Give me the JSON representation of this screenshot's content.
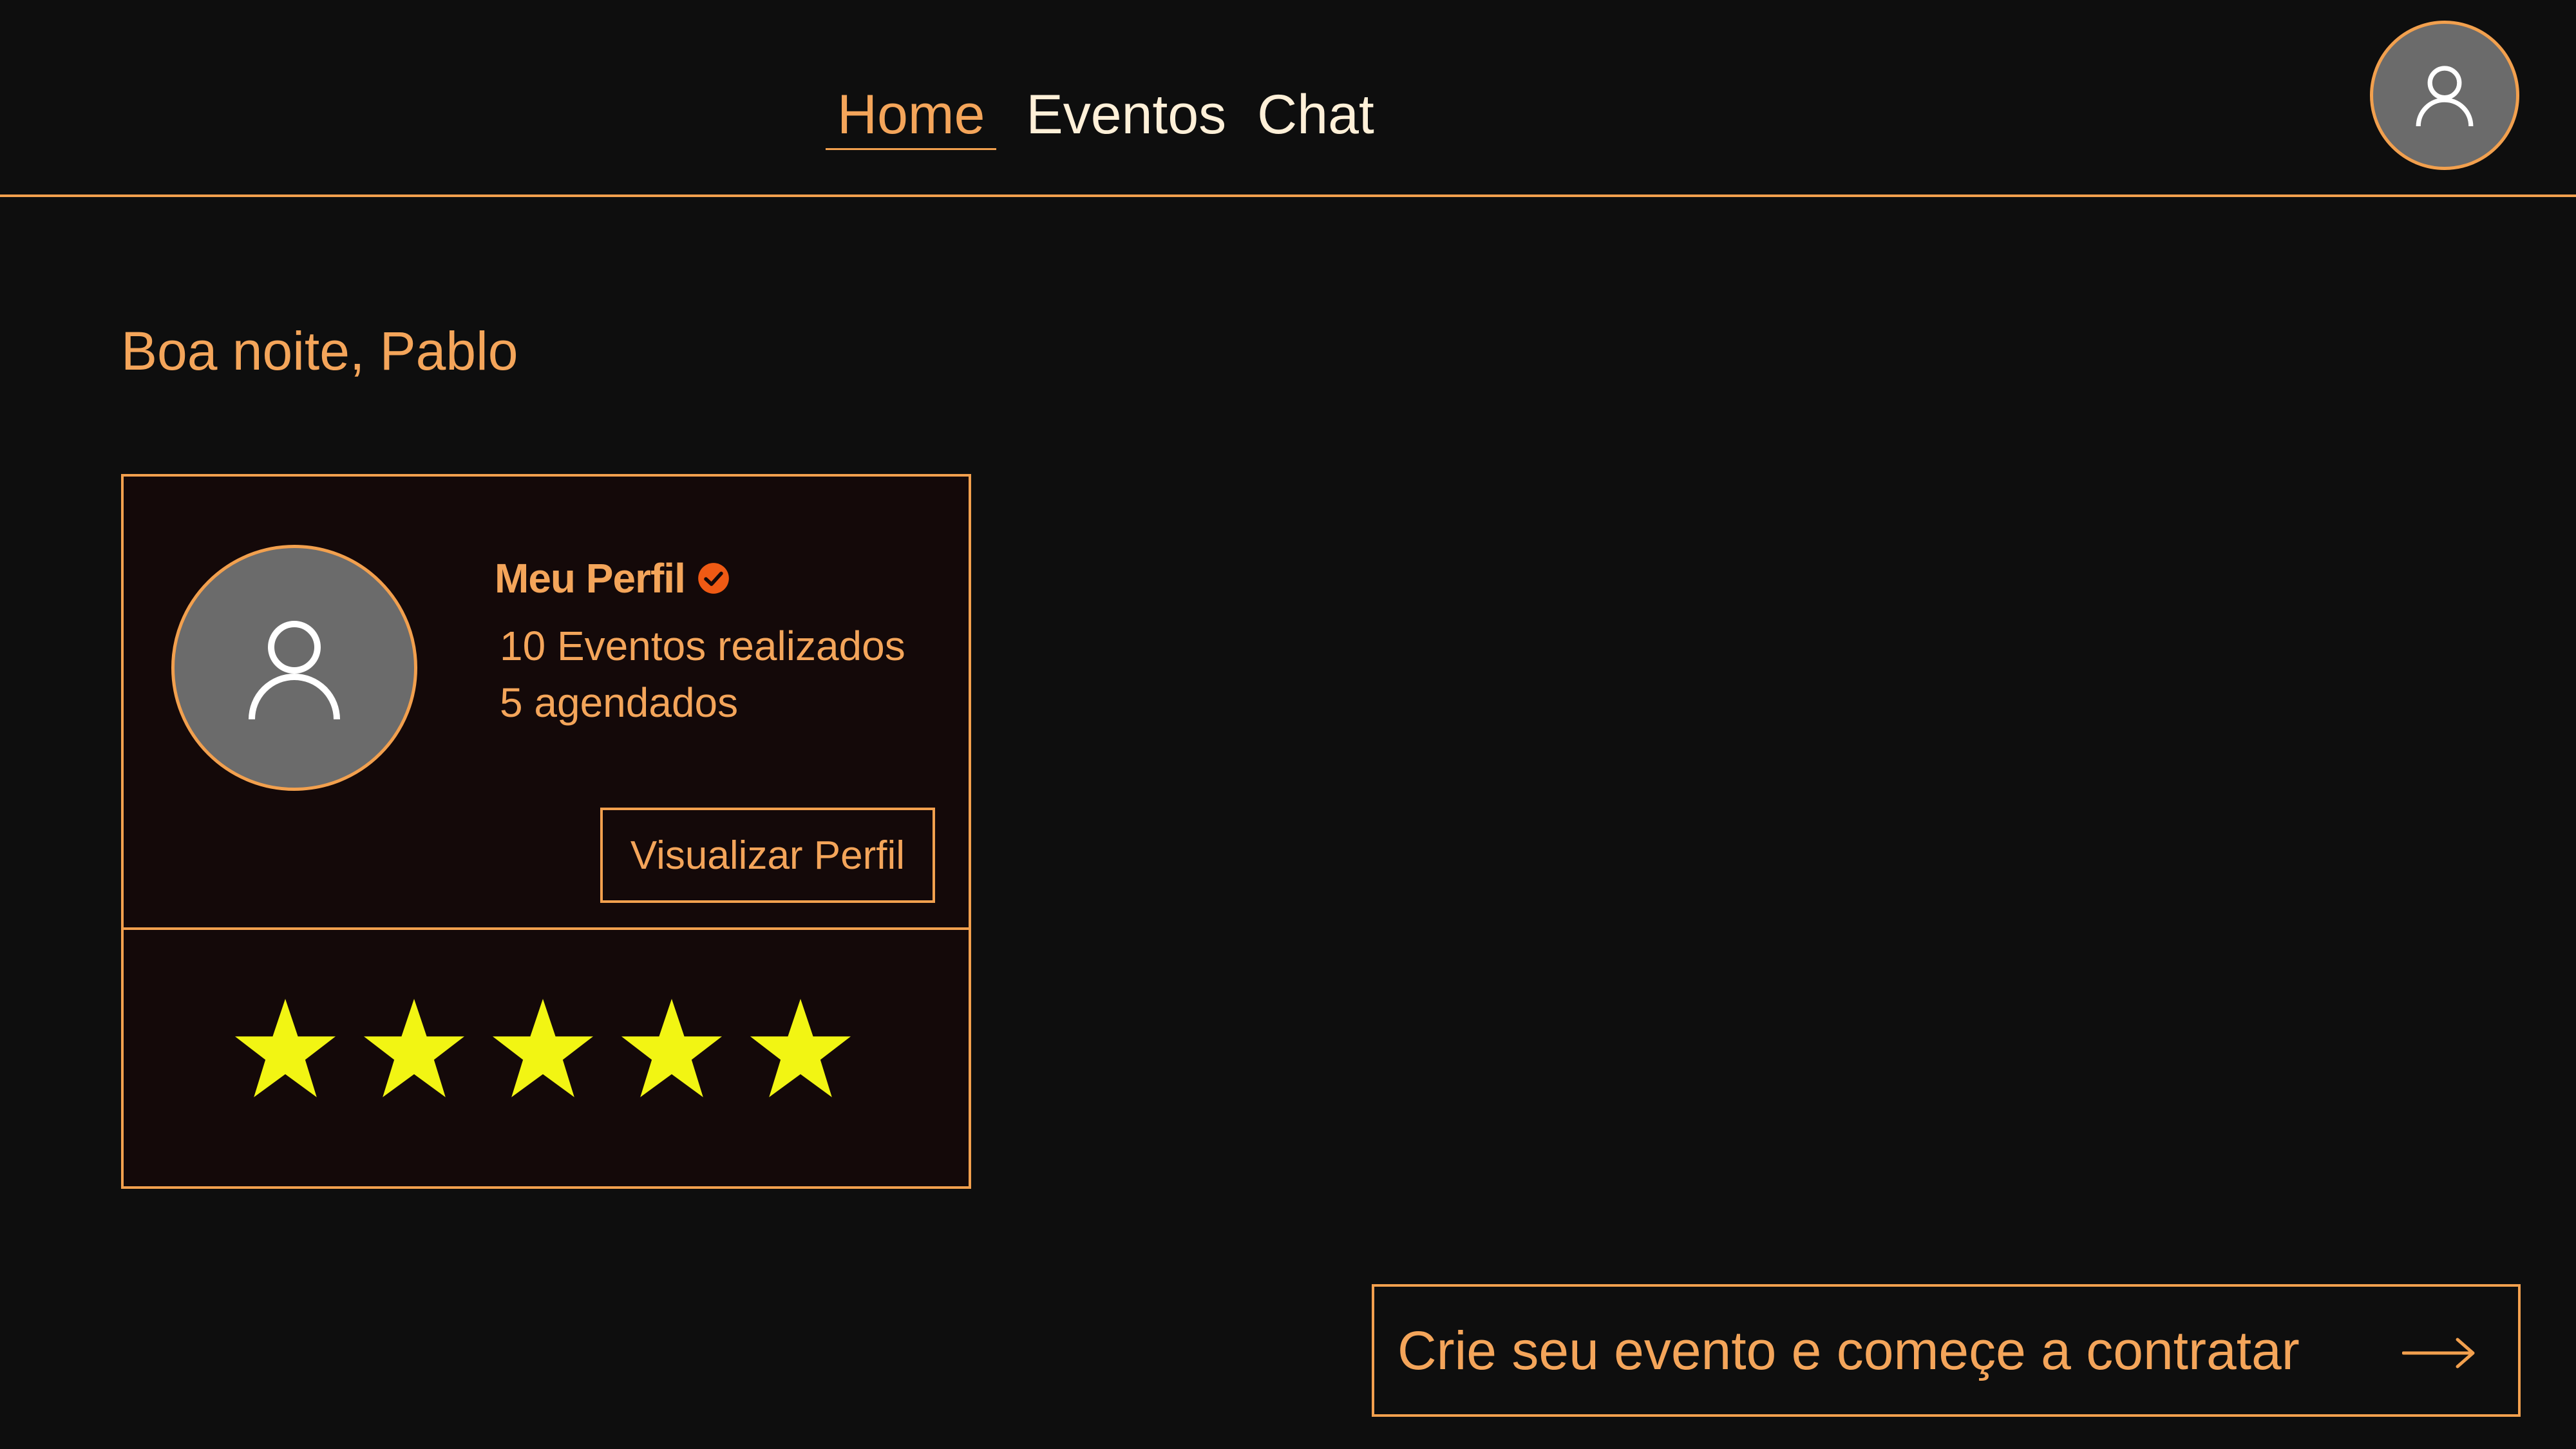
{
  "nav": {
    "items": [
      {
        "label": "Home",
        "active": true
      },
      {
        "label": "Eventos",
        "active": false
      },
      {
        "label": "Chat",
        "active": false
      }
    ]
  },
  "header": {
    "avatar_icon": "user-icon"
  },
  "greeting": "Boa noite, Pablo",
  "profile_card": {
    "title": "Meu Perfil",
    "verified_icon": "verified-badge-icon",
    "events_done": "10 Eventos realizados",
    "scheduled": "5 agendados",
    "view_button": "Visualizar Perfil",
    "rating": 5,
    "rating_max": 5
  },
  "cta": {
    "label": "Crie seu evento e começe a contratar",
    "icon": "arrow-right-icon"
  },
  "colors": {
    "background": "#0e0e0e",
    "accent": "#f2a04e",
    "card_background": "#140909",
    "avatar_fill": "#6b6b6b",
    "star": "#f2f513",
    "verified": "#f05a14",
    "nav_inactive": "#fff0d8"
  }
}
